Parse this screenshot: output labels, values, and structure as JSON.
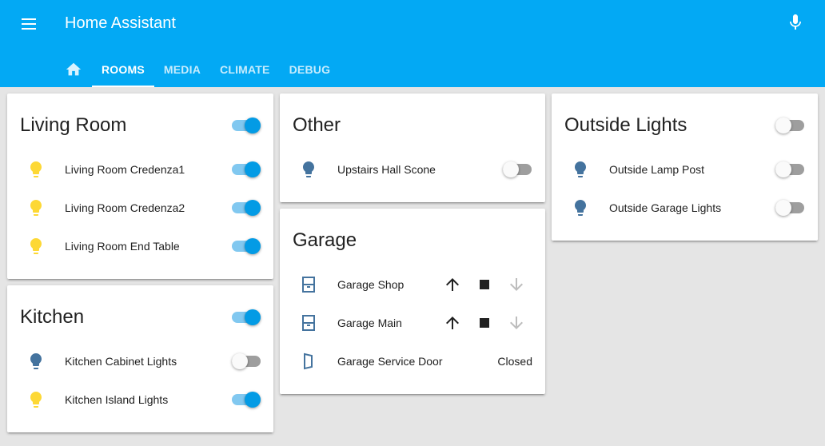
{
  "app": {
    "title": "Home Assistant"
  },
  "tabs": [
    {
      "label": "home-icon"
    },
    {
      "label": "ROOMS"
    },
    {
      "label": "MEDIA"
    },
    {
      "label": "CLIMATE"
    },
    {
      "label": "DEBUG"
    }
  ],
  "colors": {
    "accent": "#03a9f4",
    "light_on": "#fdd835",
    "light_off": "#44739e",
    "toggle_on": "#039be5"
  },
  "cards": {
    "living_room": {
      "title": "Living Room",
      "group_on": true,
      "rows": [
        {
          "label": "Living Room Credenza1",
          "on": true
        },
        {
          "label": "Living Room Credenza2",
          "on": true
        },
        {
          "label": "Living Room End Table",
          "on": true
        }
      ]
    },
    "kitchen": {
      "title": "Kitchen",
      "group_on": true,
      "rows": [
        {
          "label": "Kitchen Cabinet Lights",
          "on": false
        },
        {
          "label": "Kitchen Island Lights",
          "on": true
        }
      ]
    },
    "other": {
      "title": "Other",
      "rows": [
        {
          "label": "Upstairs Hall Scone",
          "on": false
        }
      ]
    },
    "garage": {
      "title": "Garage",
      "rows": [
        {
          "label": "Garage Shop"
        },
        {
          "label": "Garage Main"
        },
        {
          "label": "Garage Service Door",
          "state": "Closed"
        }
      ]
    },
    "outside": {
      "title": "Outside Lights",
      "group_on": false,
      "rows": [
        {
          "label": "Outside Lamp Post",
          "on": false
        },
        {
          "label": "Outside Garage Lights",
          "on": false
        }
      ]
    }
  }
}
